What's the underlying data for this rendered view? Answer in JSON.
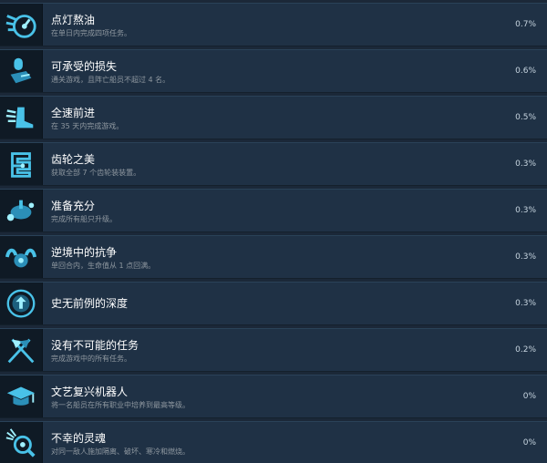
{
  "achievements": [
    {
      "title": "点灯熬油",
      "desc": "在单日内完成四项任务。",
      "pct": "0.7%",
      "icon": "sun-clock-icon"
    },
    {
      "title": "可承受的损失",
      "desc": "通关游戏，且阵亡船员不超过 4 名。",
      "pct": "0.6%",
      "icon": "tombstone-hand-icon"
    },
    {
      "title": "全速前进",
      "desc": "在 35 天内完成游戏。",
      "pct": "0.5%",
      "icon": "winged-boot-icon"
    },
    {
      "title": "齿轮之美",
      "desc": "获取全部 7 个齿轮装装置。",
      "pct": "0.3%",
      "icon": "gear-serpent-icon"
    },
    {
      "title": "准备充分",
      "desc": "完成所有船只升级。",
      "pct": "0.3%",
      "icon": "cannon-ship-icon"
    },
    {
      "title": "逆境中的抗争",
      "desc": "单回合内，生命值从 1 点回满。",
      "pct": "0.3%",
      "icon": "flexing-arms-icon"
    },
    {
      "title": "史无前例的深度",
      "desc": "",
      "pct": "0.3%",
      "icon": "depth-emblem-icon"
    },
    {
      "title": "没有不可能的任务",
      "desc": "完成游戏中的所有任务。",
      "pct": "0.2%",
      "icon": "crossed-flags-icon"
    },
    {
      "title": "文艺复兴机器人",
      "desc": "将一名船员在所有职业中培养到最高等级。",
      "pct": "0%",
      "icon": "graduation-cap-icon"
    },
    {
      "title": "不幸的灵魂",
      "desc": "对同一敌人施加隔离、破坏、寒冷和燃烧。",
      "pct": "0%",
      "icon": "cursed-soul-icon"
    }
  ]
}
